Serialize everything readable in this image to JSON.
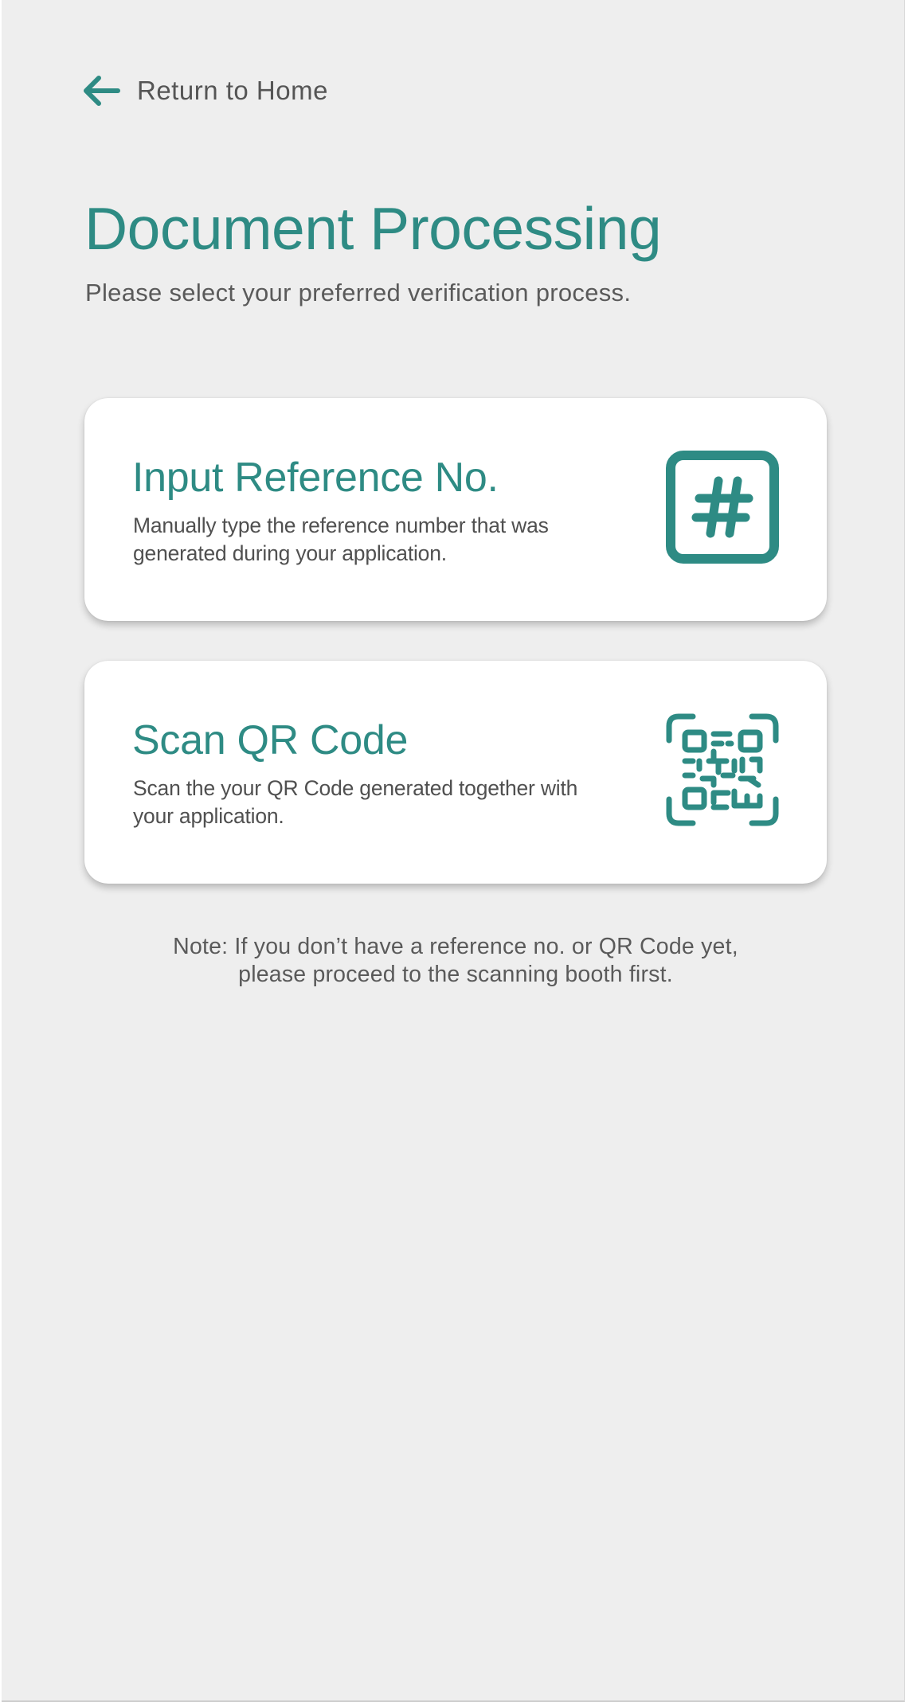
{
  "nav": {
    "back_label": "Return to Home",
    "back_icon": "arrow-left-icon"
  },
  "header": {
    "title": "Document Processing",
    "subtitle": "Please select your preferred verification process."
  },
  "options": [
    {
      "title": "Input Reference No.",
      "description": "Manually type the reference number that  was generated during your application.",
      "icon": "hash-icon"
    },
    {
      "title": "Scan QR Code",
      "description": "Scan the your QR Code generated together with your application.",
      "icon": "qr-code-icon"
    }
  ],
  "note": {
    "line1": "Note: If you don’t have a reference no. or QR Code yet,",
    "line2": "please proceed to the scanning booth first."
  },
  "colors": {
    "accent": "#2e8b84",
    "background": "#eeeeee",
    "card": "#ffffff",
    "text_muted": "#555555"
  }
}
